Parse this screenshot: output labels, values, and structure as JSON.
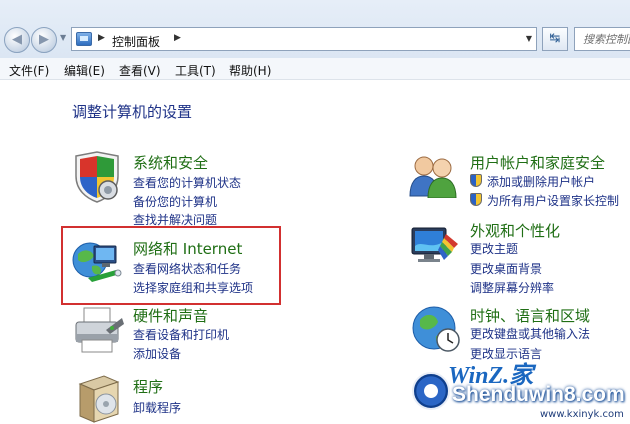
{
  "address_bar": {
    "breadcrumb": "控制面板",
    "search_placeholder": "搜索控制面"
  },
  "menu": [
    "文件(F)",
    "编辑(E)",
    "查看(V)",
    "工具(T)",
    "帮助(H)"
  ],
  "page_title": "调整计算机的设置",
  "categories_left": [
    {
      "title": "系统和安全",
      "links": [
        "查看您的计算机状态",
        "备份您的计算机",
        "查找并解决问题"
      ]
    },
    {
      "title": "网络和 Internet",
      "links": [
        "查看网络状态和任务",
        "选择家庭组和共享选项"
      ]
    },
    {
      "title": "硬件和声音",
      "links": [
        "查看设备和打印机",
        "添加设备"
      ]
    },
    {
      "title": "程序",
      "links": [
        "卸载程序"
      ]
    }
  ],
  "categories_right": [
    {
      "title": "用户帐户和家庭安全",
      "links": [
        "添加或删除用户帐户",
        "为所有用户设置家长控制"
      ]
    },
    {
      "title": "外观和个性化",
      "links": [
        "更改主题",
        "更改桌面背景",
        "调整屏幕分辨率"
      ]
    },
    {
      "title": "时钟、语言和区域",
      "links": [
        "更改键盘或其他输入法",
        "更改显示语言"
      ]
    }
  ],
  "watermark": {
    "line1": "WinZ.家",
    "line2": "Shenduwin8.com",
    "url": "www.kxinyk.com"
  },
  "colors": {
    "category_title": "#1f6e14",
    "link": "#1e3287",
    "highlight_border": "#d23030"
  }
}
